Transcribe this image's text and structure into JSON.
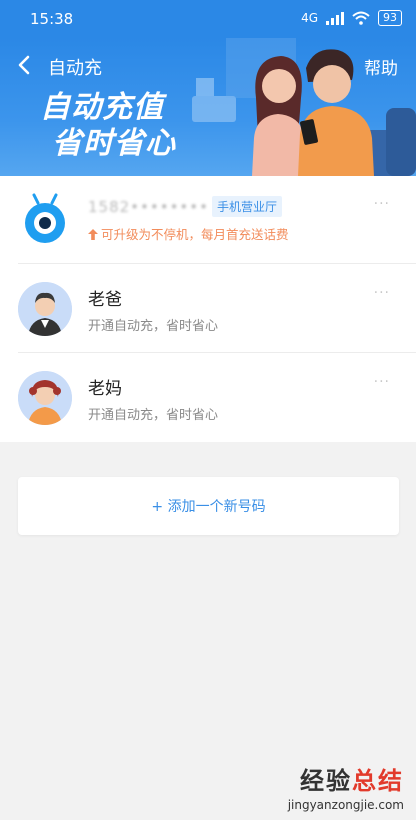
{
  "status_bar": {
    "time": "15:38",
    "network": "4G",
    "battery": "93"
  },
  "header": {
    "title": "自动充",
    "help": "帮助"
  },
  "banner": {
    "line1": "自动充值",
    "line2": "省时省心"
  },
  "accounts": [
    {
      "number": "1582••••••••",
      "tag": "手机营业厅",
      "subtitle": "可升级为不停机，每月首充送话费",
      "more": "···"
    },
    {
      "name": "老爸",
      "subtitle": "开通自动充，省时省心",
      "more": "···"
    },
    {
      "name": "老妈",
      "subtitle": "开通自动充，省时省心",
      "more": "···"
    }
  ],
  "add_button": {
    "label": "+ 添加一个新号码"
  },
  "watermark": {
    "cn_part1": "经验",
    "cn_part2": "总结",
    "url": "jingyanzongjie.com"
  },
  "colors": {
    "primary": "#2b88e6",
    "accent_orange": "#f28c5b",
    "link_blue": "#3a8fe6"
  }
}
